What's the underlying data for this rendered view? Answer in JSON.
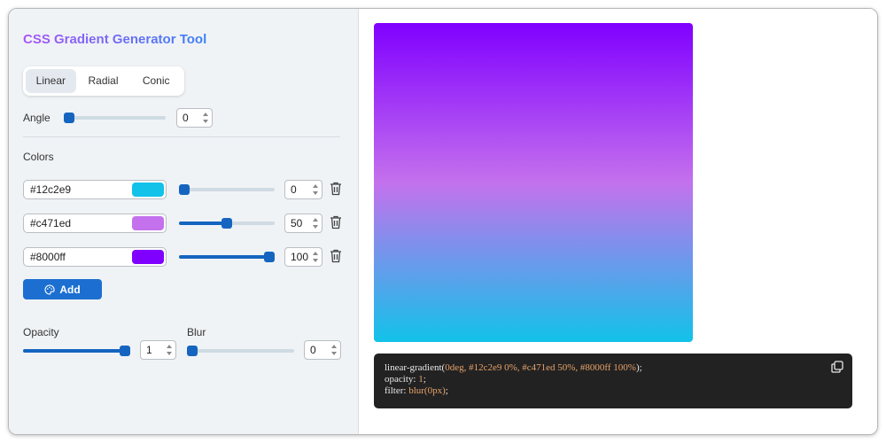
{
  "title": "CSS Gradient Generator Tool",
  "tabs": [
    {
      "label": "Linear",
      "active": true
    },
    {
      "label": "Radial",
      "active": false
    },
    {
      "label": "Conic",
      "active": false
    }
  ],
  "angle": {
    "label": "Angle",
    "value": "0",
    "slider_fraction": 0
  },
  "colors": {
    "label": "Colors",
    "stops": [
      {
        "hex": "#12c2e9",
        "swatch": "#12c2e9",
        "position": "0",
        "slider_fraction": 0
      },
      {
        "hex": "#c471ed",
        "swatch": "#c471ed",
        "position": "50",
        "slider_fraction": 0.5
      },
      {
        "hex": "#8000ff",
        "swatch": "#8000ff",
        "position": "100",
        "slider_fraction": 1
      }
    ],
    "delete_icon": "trash-icon"
  },
  "add_button": {
    "label": "Add",
    "icon": "palette-icon"
  },
  "opacity": {
    "label": "Opacity",
    "value": "1",
    "slider_fraction": 1
  },
  "blur": {
    "label": "Blur",
    "value": "0",
    "slider_fraction": 0
  },
  "code": {
    "line1_prefix": "linear-gradient(",
    "line1_value": "0deg, #12c2e9 0%, #c471ed 50%, #8000ff 100%",
    "line1_suffix": ");",
    "line2_prefix": "opacity: ",
    "line2_value": "1",
    "line2_suffix": ";",
    "line3_prefix": "filter: ",
    "line3_value": "blur(0px)",
    "line3_suffix": ";",
    "copy_icon": "copy-icon"
  },
  "colors_theme": {
    "accent": "#1565c0",
    "add_button": "#1c6fd1",
    "code_bg": "#222222",
    "code_highlight": "#e8a36a"
  }
}
